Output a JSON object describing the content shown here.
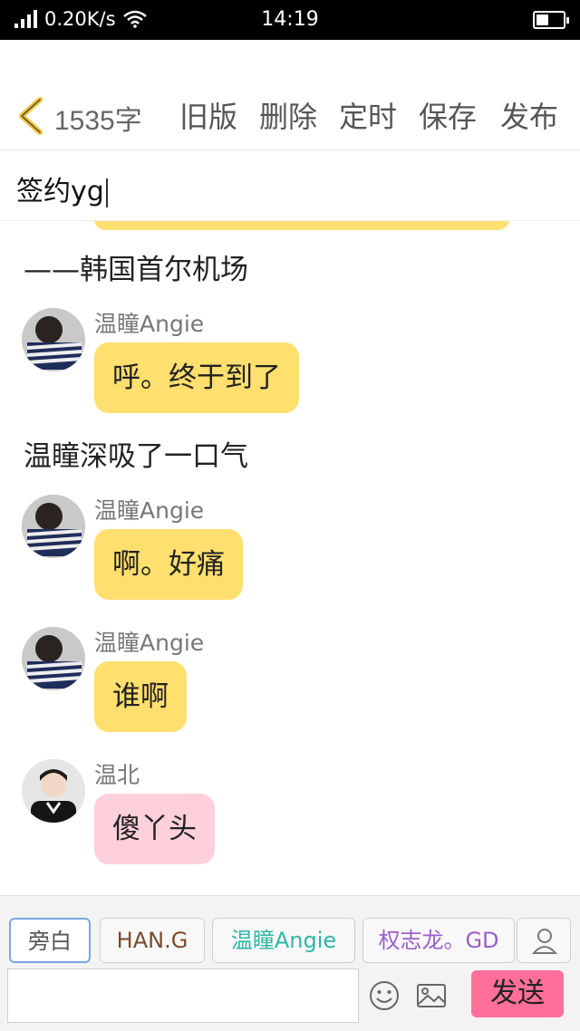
{
  "status_bar": {
    "speed": "0.20K/s",
    "time": "14:19",
    "battery_level": 0.45
  },
  "toolbar": {
    "word_count": "1535字",
    "old_version": "旧版",
    "delete": "删除",
    "schedule": "定时",
    "save": "保存",
    "publish": "发布"
  },
  "title": "签约yg",
  "content": {
    "narration_1": "——韩国首尔机场",
    "messages_1": [
      {
        "sender": "温瞳Angie",
        "text": "呼。终于到了"
      }
    ],
    "narration_2": "温瞳深吸了一口气",
    "messages_2": [
      {
        "sender": "温瞳Angie",
        "text": "啊。好痛"
      },
      {
        "sender": "温瞳Angie",
        "text": "谁啊"
      },
      {
        "sender": "温北",
        "text": "傻丫头"
      }
    ]
  },
  "characters": [
    {
      "label": "旁白",
      "color": "#555555"
    },
    {
      "label": "HAN.G",
      "color": "#7a4b2b"
    },
    {
      "label": "温瞳Angie",
      "color": "#2fb7a5"
    },
    {
      "label": "权志龙。GD",
      "color": "#9b5fc9"
    }
  ],
  "composer": {
    "input_value": "",
    "send_label": "发送"
  },
  "colors": {
    "bubble_yellow": "#ffdf6e",
    "bubble_pink": "#fdd0dc",
    "send_button": "#ff6f9a"
  }
}
